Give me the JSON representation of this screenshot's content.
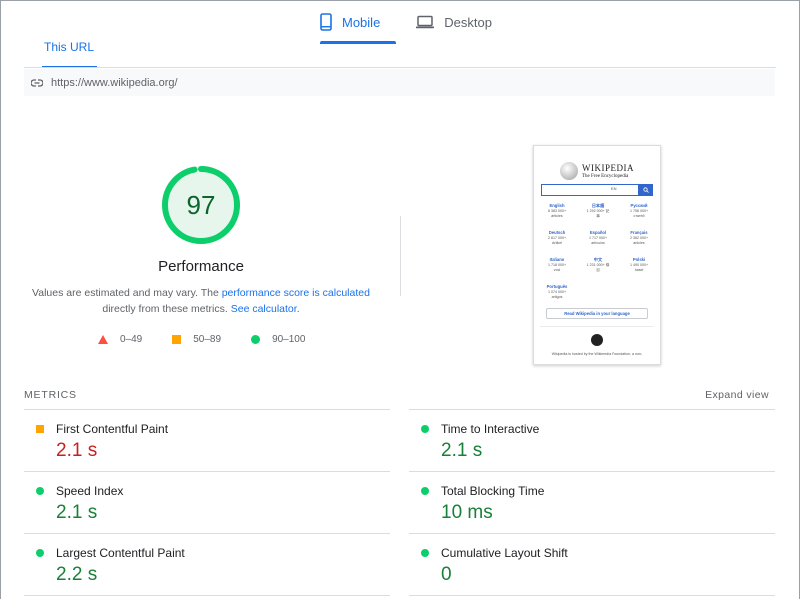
{
  "device_tabs": [
    {
      "label": "Mobile",
      "active": true,
      "icon": "phone-icon"
    },
    {
      "label": "Desktop",
      "active": false,
      "icon": "laptop-icon"
    }
  ],
  "url_tab": {
    "label": "This URL"
  },
  "url": "https://www.wikipedia.org/",
  "score": {
    "value": "97",
    "fraction": 0.97,
    "label": "Performance",
    "color": "#0cce6b",
    "note_prefix": "Values are estimated and may vary. The ",
    "note_link1": "performance score is calculated",
    "note_middle": " directly from these metrics. ",
    "note_link2": "See calculator."
  },
  "legend": [
    {
      "range": "0–49",
      "shape": "triangle",
      "color": "#ff4e42"
    },
    {
      "range": "50–89",
      "shape": "square",
      "color": "#ffa400"
    },
    {
      "range": "90–100",
      "shape": "circle",
      "color": "#0cce6b"
    }
  ],
  "thumbnail": {
    "title": "WIKIPEDIA",
    "subtitle": "The Free Encyclopedia",
    "search_lang": "EN",
    "languages": [
      {
        "name": "English",
        "count": "6 383 000+",
        "unit": "articles"
      },
      {
        "name": "日本語",
        "count": "1 292 000+ 記",
        "unit": "事"
      },
      {
        "name": "Русский",
        "count": "1 756 000+",
        "unit": "статей"
      },
      {
        "name": "Deutsch",
        "count": "2 617 000+",
        "unit": "Artikel"
      },
      {
        "name": "Español",
        "count": "1 717 000+",
        "unit": "artículos"
      },
      {
        "name": "Français",
        "count": "2 362 000+",
        "unit": "articles"
      },
      {
        "name": "Italiano",
        "count": "1 718 000+",
        "unit": "voci"
      },
      {
        "name": "中文",
        "count": "1 231 000+ 條",
        "unit": "目"
      },
      {
        "name": "Polski",
        "count": "1 490 000+",
        "unit": "haseł"
      },
      {
        "name": "Português",
        "count": "1 074 000+",
        "unit": "artigos"
      }
    ],
    "read_button": "Read Wikipedia in your language",
    "footer": "Wikipedia is hosted by the Wikimedia Foundation, a non-"
  },
  "metrics": {
    "title": "METRICS",
    "expand_label": "Expand view",
    "items": [
      {
        "label": "First Contentful Paint",
        "value": "2.1 s",
        "rating": "average"
      },
      {
        "label": "Time to Interactive",
        "value": "2.1 s",
        "rating": "pass"
      },
      {
        "label": "Speed Index",
        "value": "2.1 s",
        "rating": "pass"
      },
      {
        "label": "Total Blocking Time",
        "value": "10 ms",
        "rating": "pass"
      },
      {
        "label": "Largest Contentful Paint",
        "value": "2.2 s",
        "rating": "pass"
      },
      {
        "label": "Cumulative Layout Shift",
        "value": "0",
        "rating": "pass"
      }
    ]
  },
  "colors": {
    "accent": "#1a73e8",
    "pass": "#0cce6b",
    "average": "#ffa400",
    "fail": "#ff4e42"
  }
}
